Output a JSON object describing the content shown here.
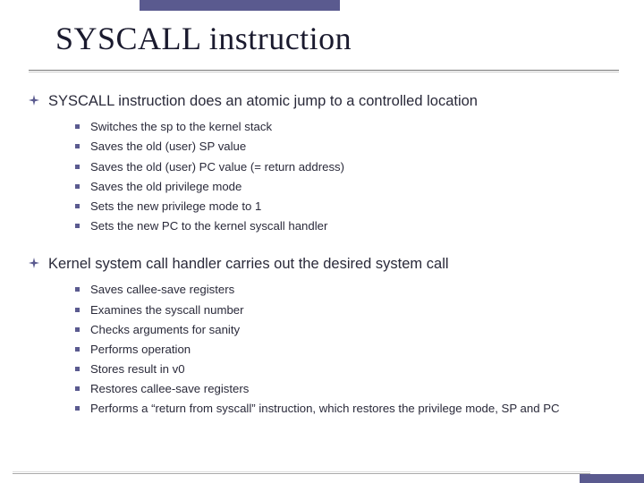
{
  "title": "SYSCALL instruction",
  "sections": [
    {
      "heading": "SYSCALL instruction does an atomic jump to a controlled location",
      "items": [
        "Switches the sp to the kernel stack",
        "Saves the old (user) SP value",
        "Saves the old (user) PC value (= return address)",
        "Saves the old privilege mode",
        "Sets the new privilege mode to 1",
        "Sets the new PC to the kernel syscall handler"
      ]
    },
    {
      "heading": "Kernel system call handler carries out the desired system call",
      "items": [
        "Saves callee-save registers",
        "Examines the syscall number",
        "Checks arguments for sanity",
        "Performs operation",
        "Stores result in v0",
        "Restores callee-save registers",
        "Performs a “return from syscall” instruction, which restores the privilege mode, SP and PC"
      ]
    }
  ]
}
